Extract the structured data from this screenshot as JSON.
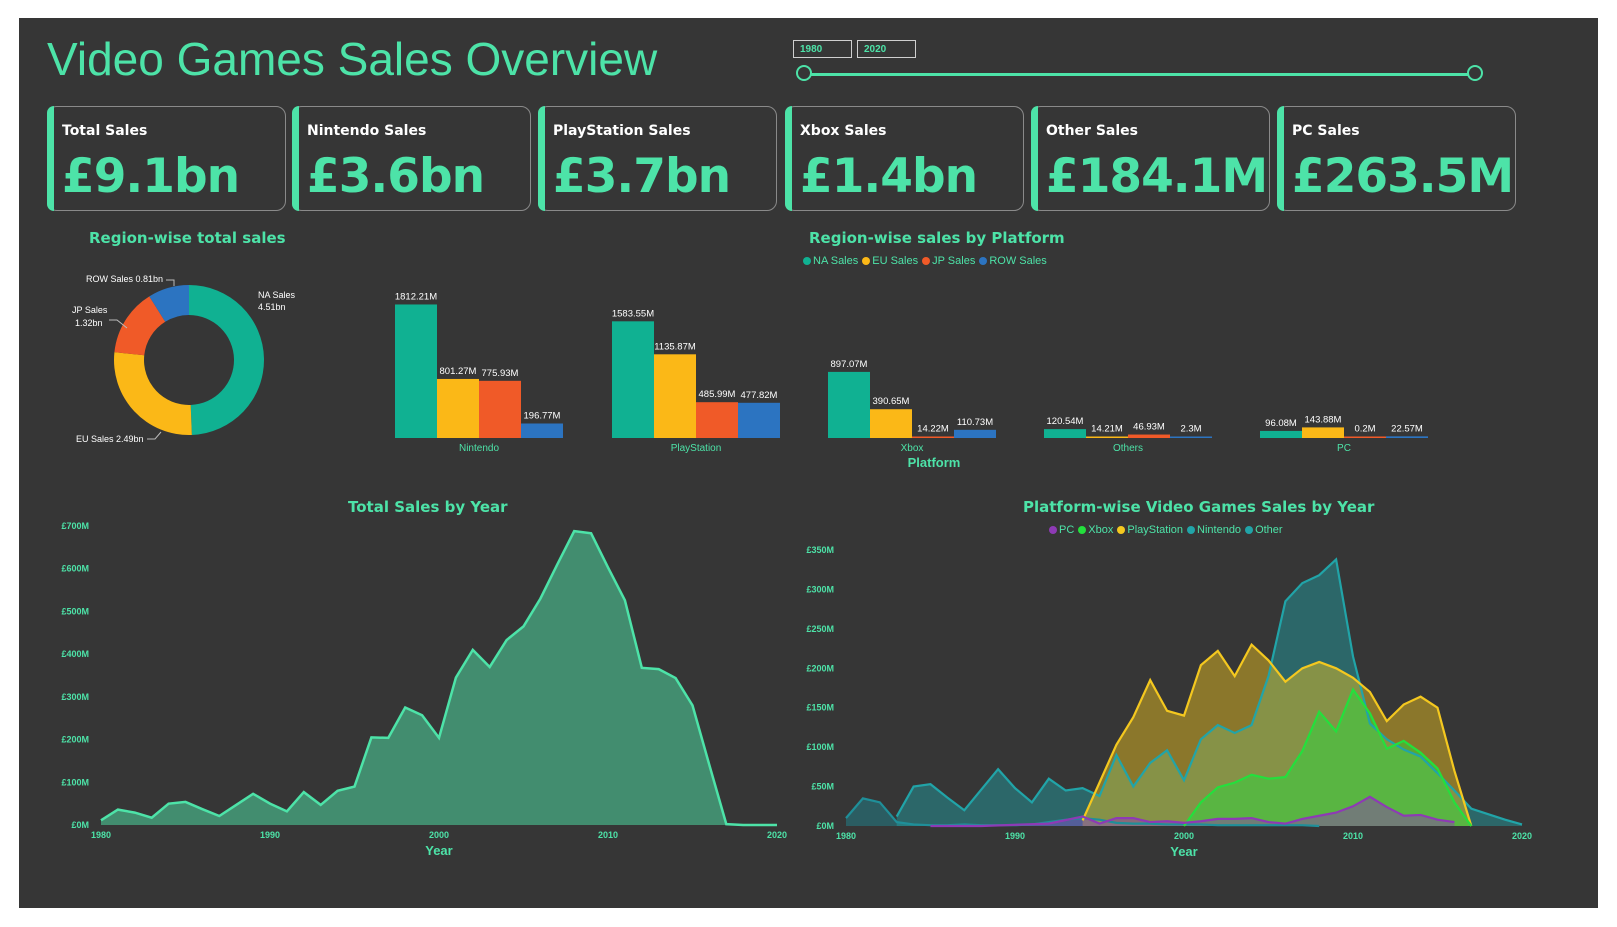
{
  "header": {
    "title": "Video Games Sales Overview",
    "date_start": "1980",
    "date_end": "2020"
  },
  "kpis": [
    {
      "label": "Total Sales",
      "value": "£9.1bn"
    },
    {
      "label": "Nintendo Sales",
      "value": "£3.6bn"
    },
    {
      "label": "PlayStation Sales",
      "value": "£3.7bn"
    },
    {
      "label": "Xbox Sales",
      "value": "£1.4bn"
    },
    {
      "label": "Other Sales",
      "value": "£184.1M"
    },
    {
      "label": "PC Sales",
      "value": "£263.5M"
    }
  ],
  "colors": {
    "accent": "#4de3a8",
    "na": "#10b192",
    "eu": "#fbb817",
    "jp": "#f05a28",
    "row": "#2c74c1",
    "pc": "#8e3ab5",
    "xbox": "#23e03c",
    "playstation": "#f4c81f",
    "nintendo": "#21a4a8",
    "other": "#1f8f99"
  },
  "chart_data": [
    {
      "type": "pie",
      "title": "Region-wise total sales",
      "donut": true,
      "slices": [
        {
          "label": "NA Sales",
          "value_label": "4.51bn",
          "value": 4.51,
          "color": "#10b192"
        },
        {
          "label": "EU Sales",
          "value_label": "2.49bn",
          "value": 2.49,
          "color": "#fbb817"
        },
        {
          "label": "JP Sales",
          "value_label": "1.32bn",
          "value": 1.32,
          "color": "#f05a28"
        },
        {
          "label": "ROW Sales",
          "value_label": "0.81bn",
          "value": 0.81,
          "color": "#2c74c1"
        }
      ]
    },
    {
      "type": "bar",
      "title": "Region-wise sales by Platform",
      "xlabel": "Platform",
      "categories": [
        "Nintendo",
        "PlayStation",
        "Xbox",
        "Others",
        "PC"
      ],
      "series": [
        {
          "name": "NA Sales",
          "values": [
            1812.21,
            1583.55,
            897.07,
            120.54,
            96.08
          ],
          "labels": [
            "1812.21M",
            "1583.55M",
            "897.07M",
            "120.54M",
            "96.08M"
          ],
          "color": "#10b192"
        },
        {
          "name": "EU Sales",
          "values": [
            801.27,
            1135.87,
            390.65,
            14.21,
            143.88
          ],
          "labels": [
            "801.27M",
            "1135.87M",
            "390.65M",
            "14.21M",
            "143.88M"
          ],
          "color": "#fbb817"
        },
        {
          "name": "JP Sales",
          "values": [
            775.93,
            485.99,
            14.22,
            46.93,
            0.2
          ],
          "labels": [
            "775.93M",
            "485.99M",
            "14.22M",
            "46.93M",
            "0.2M"
          ],
          "color": "#f05a28"
        },
        {
          "name": "ROW Sales",
          "values": [
            196.77,
            477.82,
            110.73,
            2.3,
            22.57
          ],
          "labels": [
            "196.77M",
            "477.82M",
            "110.73M",
            "2.3M",
            "22.57M"
          ],
          "color": "#2c74c1"
        }
      ],
      "ylim": [
        0,
        1900
      ]
    },
    {
      "type": "area",
      "title": "Total Sales by Year",
      "xlabel": "Year",
      "ylabel": "",
      "x": [
        1980,
        1981,
        1982,
        1983,
        1984,
        1985,
        1986,
        1987,
        1988,
        1989,
        1990,
        1991,
        1992,
        1993,
        1994,
        1995,
        1996,
        1997,
        1998,
        1999,
        2000,
        2001,
        2002,
        2003,
        2004,
        2005,
        2006,
        2007,
        2008,
        2009,
        2010,
        2011,
        2012,
        2013,
        2014,
        2015,
        2016,
        2017,
        2018,
        2019,
        2020
      ],
      "y": [
        11,
        36,
        29,
        17,
        50,
        54,
        37,
        21,
        47,
        73,
        50,
        32,
        77,
        47,
        80,
        90,
        205,
        204,
        275,
        257,
        204,
        345,
        410,
        370,
        433,
        465,
        530,
        610,
        688,
        683,
        603,
        526,
        368,
        365,
        344,
        280,
        140,
        2,
        0,
        0,
        0
      ],
      "xlim": [
        1980,
        2020
      ],
      "ylim": [
        0,
        700
      ],
      "yticks": [
        "£0M",
        "£100M",
        "£200M",
        "£300M",
        "£400M",
        "£500M",
        "£600M",
        "£700M"
      ],
      "xticks": [
        "1980",
        "1990",
        "2000",
        "2010",
        "2020"
      ],
      "color": "#4de3a8"
    },
    {
      "type": "area",
      "title": "Platform-wise Video Games Sales by Year",
      "xlabel": "Year",
      "xlim": [
        1980,
        2020
      ],
      "ylim": [
        0,
        350
      ],
      "yticks": [
        "£0M",
        "£50M",
        "£100M",
        "£150M",
        "£200M",
        "£250M",
        "£300M",
        "£350M"
      ],
      "xticks": [
        "1980",
        "1990",
        "2000",
        "2010",
        "2020"
      ],
      "series": [
        {
          "name": "PC",
          "color": "#8e3ab5",
          "x": [
            1985,
            1988,
            1992,
            1994,
            1995,
            1996,
            1997,
            1998,
            1999,
            2000,
            2001,
            2002,
            2003,
            2004,
            2005,
            2006,
            2007,
            2008,
            2009,
            2010,
            2011,
            2012,
            2013,
            2014,
            2015,
            2016
          ],
          "y": [
            0,
            0,
            3,
            12,
            3,
            10,
            10,
            5,
            6,
            4,
            6,
            9,
            9,
            10,
            5,
            3,
            9,
            13,
            17,
            25,
            37,
            24,
            13,
            14,
            8,
            5
          ]
        },
        {
          "name": "Xbox",
          "color": "#23e03c",
          "x": [
            2000,
            2001,
            2002,
            2003,
            2004,
            2005,
            2006,
            2007,
            2008,
            2009,
            2010,
            2011,
            2012,
            2013,
            2014,
            2015,
            2016,
            2017
          ],
          "y": [
            0,
            30,
            49,
            55,
            65,
            60,
            62,
            95,
            145,
            120,
            173,
            143,
            98,
            108,
            93,
            73,
            30,
            0
          ]
        },
        {
          "name": "PlayStation",
          "color": "#f4c81f",
          "x": [
            1994,
            1995,
            1996,
            1997,
            1998,
            1999,
            2000,
            2001,
            2002,
            2003,
            2004,
            2005,
            2006,
            2007,
            2008,
            2009,
            2010,
            2011,
            2012,
            2013,
            2014,
            2015,
            2016,
            2017
          ],
          "y": [
            7,
            55,
            103,
            138,
            185,
            146,
            140,
            204,
            222,
            190,
            230,
            210,
            183,
            200,
            208,
            200,
            188,
            170,
            133,
            154,
            164,
            150,
            70,
            0
          ]
        },
        {
          "name": "Nintendo",
          "color": "#21a4a8",
          "x": [
            1983,
            1984,
            1985,
            1986,
            1987,
            1988,
            1989,
            1990,
            1991,
            1992,
            1993,
            1994,
            1995,
            1996,
            1997,
            1998,
            1999,
            2000,
            2001,
            2002,
            2003,
            2004,
            2005,
            2006,
            2007,
            2008,
            2009,
            2010,
            2011,
            2012,
            2013,
            2014,
            2015,
            2016,
            2017,
            2018,
            2019,
            2020
          ],
          "y": [
            12,
            50,
            53,
            36,
            20,
            46,
            72,
            48,
            30,
            60,
            45,
            48,
            38,
            90,
            50,
            80,
            96,
            58,
            110,
            128,
            118,
            128,
            190,
            285,
            308,
            318,
            338,
            215,
            130,
            110,
            97,
            88,
            67,
            45,
            22,
            15,
            8,
            2
          ]
        },
        {
          "name": "Other",
          "color": "#1f8f99",
          "x": [
            1980,
            1981,
            1982,
            1983,
            1984,
            1985,
            1986,
            1987,
            1988,
            1989,
            1990,
            1991,
            1992,
            1993,
            1994,
            1995,
            1996,
            1997,
            1998,
            1999,
            2000,
            2001,
            2002,
            2003,
            2004,
            2005,
            2006,
            2007,
            2008
          ],
          "y": [
            10,
            35,
            30,
            5,
            2,
            1,
            1,
            2,
            1,
            1,
            1,
            2,
            5,
            8,
            10,
            8,
            4,
            3,
            3,
            2,
            2,
            2,
            1,
            1,
            1,
            1,
            1,
            1,
            0
          ]
        }
      ]
    }
  ],
  "labels": {
    "region_bar_title": "Region-wise sales by Platform",
    "donut_title": "Region-wise total sales",
    "year_title": "Total Sales by Year",
    "platform_year_title": "Platform-wise Video Games Sales by Year"
  }
}
